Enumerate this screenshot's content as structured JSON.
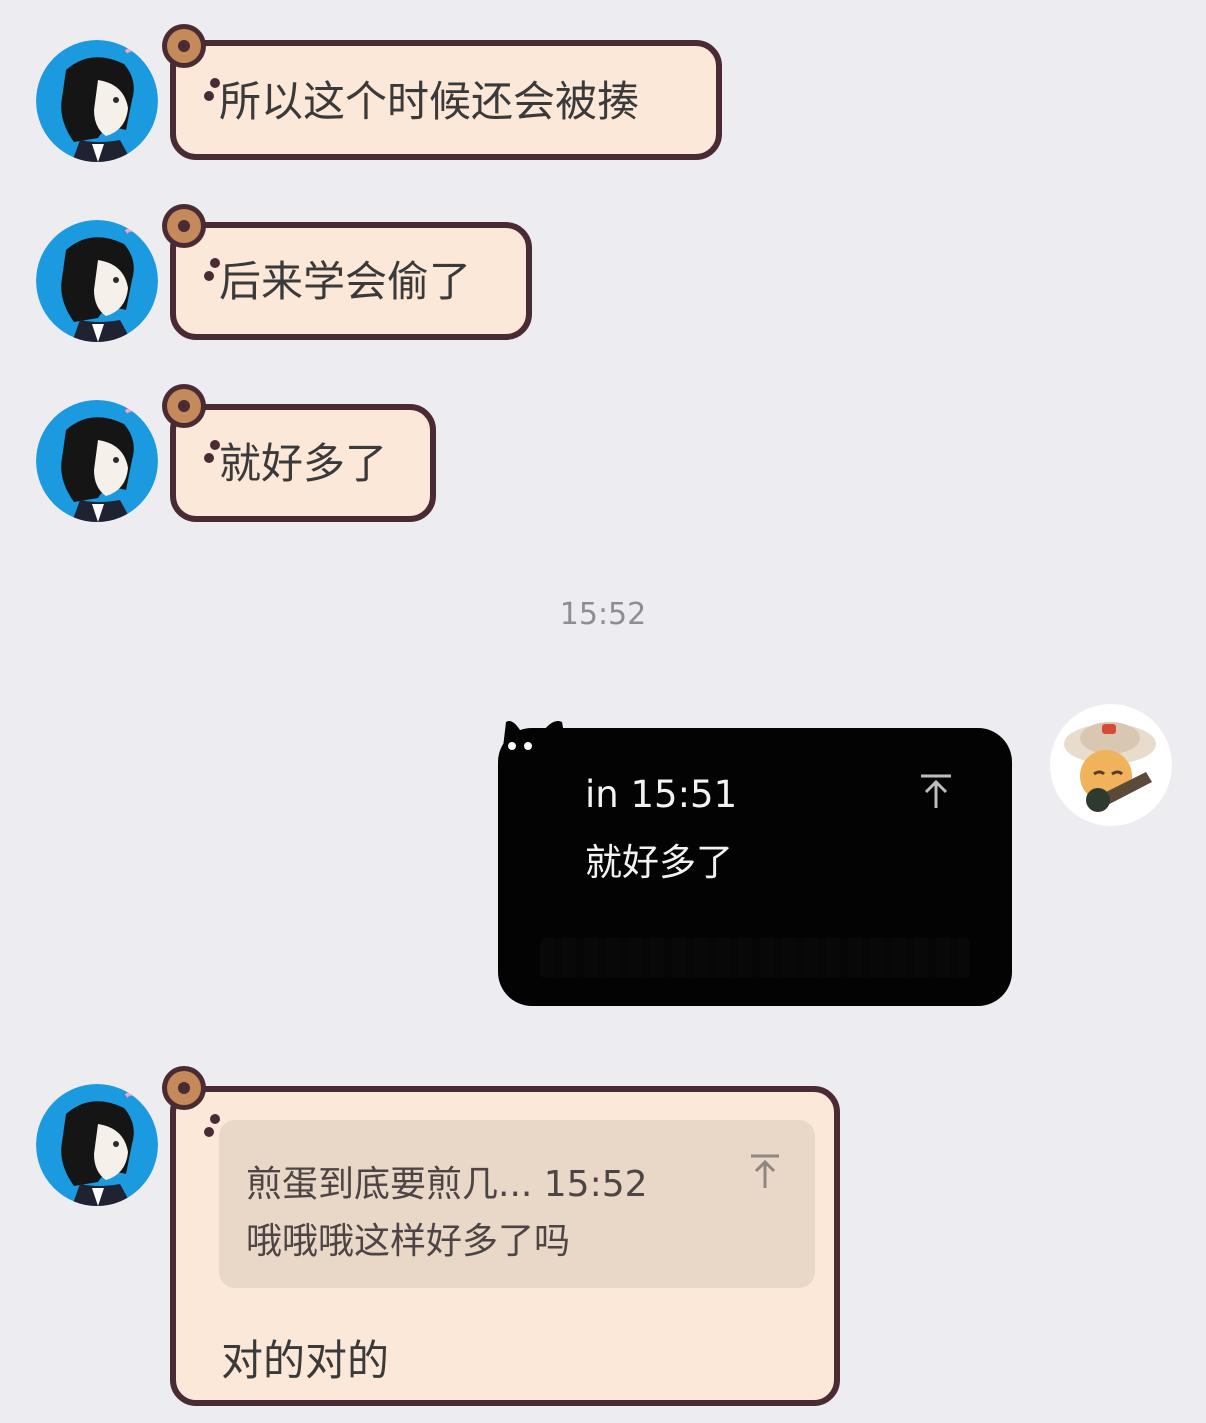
{
  "messages": [
    {
      "text": "所以这个时候还会被揍"
    },
    {
      "text": "后来学会偷了"
    },
    {
      "text": "就好多了"
    }
  ],
  "timestamp": "15:52",
  "my_message": {
    "quote_meta": "in 15:51",
    "quote_text": "就好多了"
  },
  "last_message": {
    "quote_meta": "煎蛋到底要煎几... 15:52",
    "quote_text": "哦哦哦这样好多了吗",
    "text": "对的对的"
  },
  "icons": {
    "jump_to_quote": "arrow-up-to-line-icon",
    "avatar_left": "anime-boy-avatar",
    "avatar_right": "cartoon-character-avatar",
    "bubble_decoration": "donut-icon"
  },
  "colors": {
    "background": "#ededf1",
    "bubble_fill": "#fbe8d8",
    "bubble_border": "#4a2b33",
    "dark_bubble": "#030303",
    "timestamp": "#8d8d96"
  }
}
